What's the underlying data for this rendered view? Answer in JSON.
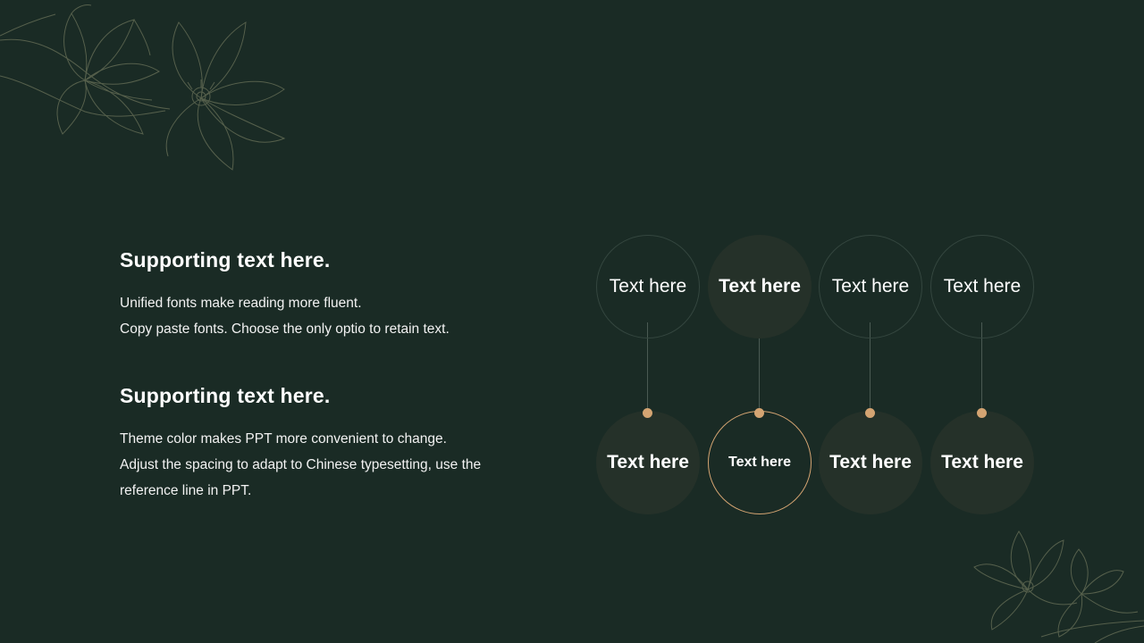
{
  "colors": {
    "background": "#1a2b25",
    "accent": "#d4a472",
    "circle_fill": "#253129",
    "circle_outline": "#34463f",
    "line_art": "#56604c"
  },
  "left_panel": {
    "blocks": [
      {
        "heading": "Supporting text here.",
        "lines": [
          "Unified fonts make reading more fluent.",
          "Copy paste fonts. Choose the only optio to retain text."
        ]
      },
      {
        "heading": "Supporting text here.",
        "lines": [
          "Theme color makes PPT more convenient to change.",
          "Adjust the spacing to adapt to Chinese typesetting, use the",
          "reference line in PPT."
        ]
      }
    ]
  },
  "diagram": {
    "top_row": [
      "Text here",
      "Text here",
      "Text here",
      "Text here"
    ],
    "bottom_row": [
      "Text here",
      "Text here",
      "Text here",
      "Text here"
    ]
  },
  "decorations": {
    "top_left": "lotus-flower-line-art",
    "bottom_right": "lotus-flower-line-art"
  }
}
